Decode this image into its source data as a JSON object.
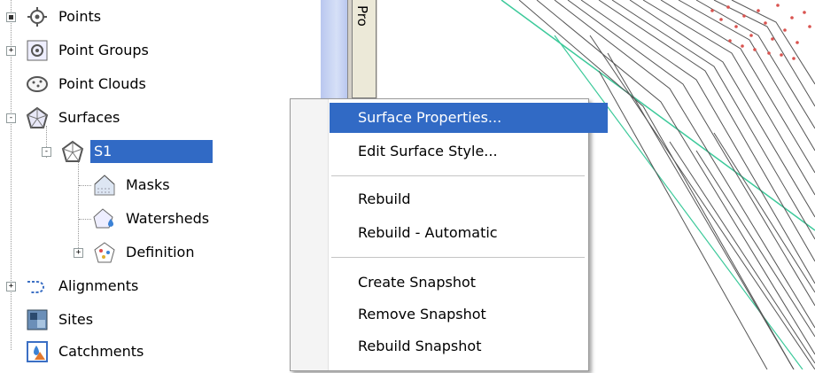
{
  "tree": {
    "items": [
      {
        "label": "Points",
        "icon": "points-icon",
        "toggle": "none"
      },
      {
        "label": "Point Groups",
        "icon": "point-groups-icon",
        "toggle": "+"
      },
      {
        "label": "Point Clouds",
        "icon": "point-clouds-icon",
        "toggle": "none"
      },
      {
        "label": "Surfaces",
        "icon": "surfaces-icon",
        "toggle": "-"
      },
      {
        "label": "S1",
        "icon": "surface-icon",
        "toggle": "-",
        "selected": true
      },
      {
        "label": "Masks",
        "icon": "masks-icon",
        "toggle": "none"
      },
      {
        "label": "Watersheds",
        "icon": "watersheds-icon",
        "toggle": "none"
      },
      {
        "label": "Definition",
        "icon": "definition-icon",
        "toggle": "+"
      },
      {
        "label": "Alignments",
        "icon": "alignments-icon",
        "toggle": "+"
      },
      {
        "label": "Sites",
        "icon": "sites-icon",
        "toggle": "none"
      },
      {
        "label": "Catchments",
        "icon": "catchments-icon",
        "toggle": "none"
      }
    ]
  },
  "palette_tab": {
    "label": "Pro"
  },
  "context_menu": {
    "items": [
      {
        "label": "Surface Properties...",
        "highlighted": true
      },
      {
        "label": "Edit Surface Style..."
      },
      {
        "label": "Rebuild"
      },
      {
        "label": "Rebuild - Automatic"
      },
      {
        "label": "Create Snapshot"
      },
      {
        "label": "Remove Snapshot"
      },
      {
        "label": "Rebuild Snapshot"
      }
    ]
  },
  "colors": {
    "selection": "#316ac5",
    "contour": "#555555",
    "boundary": "#3cc99a",
    "points": "#d9534f"
  }
}
